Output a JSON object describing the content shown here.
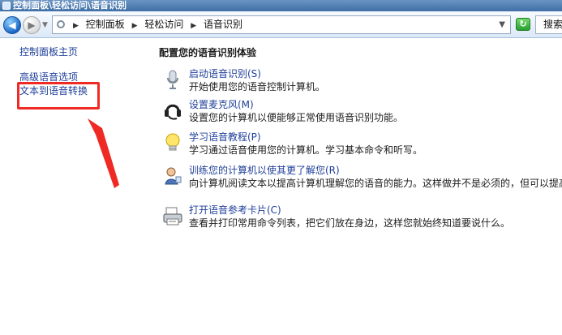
{
  "window": {
    "title": "控制面板\\轻松访问\\语音识别"
  },
  "navigation": {
    "back": "back",
    "forward": "forward",
    "breadcrumbs": [
      "控制面板",
      "轻松访问",
      "语音识别"
    ],
    "search_text": "搜索控"
  },
  "left_nav": {
    "items": [
      {
        "label": "控制面板主页"
      },
      {
        "label": "高级语音选项"
      },
      {
        "label": "文本到语音转换"
      }
    ]
  },
  "main": {
    "title": "配置您的语音识别体验",
    "tasks": [
      {
        "link": "启动语音识别(S)",
        "description": "开始使用您的语音控制计算机。",
        "icon": "microphone-icon"
      },
      {
        "link": "设置麦克风(M)",
        "description": "设置您的计算机以便能够正常使用语音识别功能。",
        "icon": "headset-icon"
      },
      {
        "link": "学习语音教程(P)",
        "description": "学习通过语音使用您的计算机。学习基本命令和听写。",
        "icon": "lightbulb-icon"
      },
      {
        "link": "训练您的计算机以使其更了解您(R)",
        "description": "向计算机阅读文本以提高计算机理解您的语音的能力。这样做并不是必须的，但可以提高听写准确性",
        "icon": "user-train-icon"
      },
      {
        "link": "打开语音参考卡片(C)",
        "description": "查看并打印常用命令列表，把它们放在身边，这样您就始终知道要说什么。",
        "icon": "printer-icon"
      }
    ]
  },
  "annotation": {
    "highlight_target": "文本到语音转换",
    "highlight_color": "#ef2a24"
  }
}
